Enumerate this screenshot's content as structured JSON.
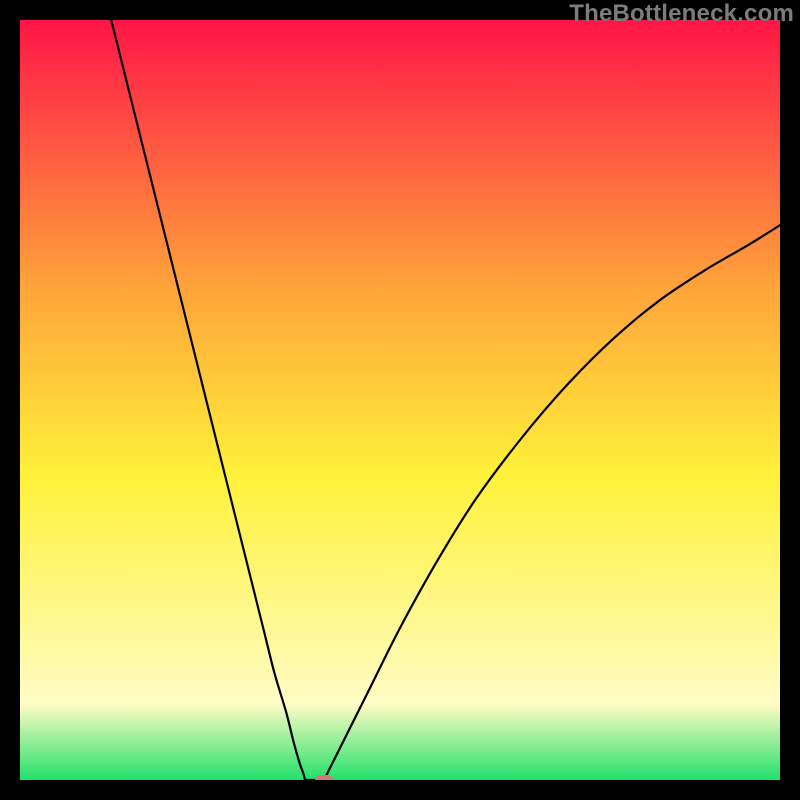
{
  "watermark": "TheBottleneck.com",
  "colors": {
    "frame": "#000000",
    "gradient_top": "#ff1547",
    "gradient_mid": "#ffa33a",
    "gradient_yellow": "#fff13a",
    "gradient_pale": "#fffcc4",
    "gradient_green": "#22e06a",
    "curve": "#000000",
    "marker": "#cf7a78"
  },
  "chart_data": {
    "type": "line",
    "title": "",
    "xlabel": "",
    "ylabel": "",
    "xlim": [
      0,
      100
    ],
    "ylim": [
      0,
      100
    ],
    "series": [
      {
        "name": "bottleneck-curve-left",
        "x": [
          12,
          14,
          16,
          18,
          20,
          22,
          24,
          26,
          28,
          30,
          32,
          33.5,
          35,
          36,
          36.8,
          37.3,
          37.5
        ],
        "values": [
          100,
          92,
          84,
          76,
          68,
          60,
          52,
          44,
          36,
          28,
          20,
          14,
          9,
          5,
          2.2,
          0.8,
          0
        ]
      },
      {
        "name": "floor-segment",
        "x": [
          37.5,
          40
        ],
        "values": [
          0,
          0
        ]
      },
      {
        "name": "bottleneck-curve-right",
        "x": [
          40,
          41,
          43,
          46,
          50,
          55,
          60,
          66,
          72,
          78,
          84,
          90,
          96,
          100
        ],
        "values": [
          0,
          2,
          6,
          12,
          20,
          29,
          37,
          45,
          52,
          58,
          63,
          67,
          70.5,
          73
        ]
      }
    ],
    "marker": {
      "x": 40,
      "y": 0
    },
    "gradient_stops": [
      {
        "offset": 0,
        "color_key": "gradient_top"
      },
      {
        "offset": 35,
        "color_key": "gradient_mid"
      },
      {
        "offset": 60,
        "color_key": "gradient_yellow"
      },
      {
        "offset": 90,
        "color_key": "gradient_pale"
      },
      {
        "offset": 100,
        "color_key": "gradient_green"
      }
    ]
  }
}
